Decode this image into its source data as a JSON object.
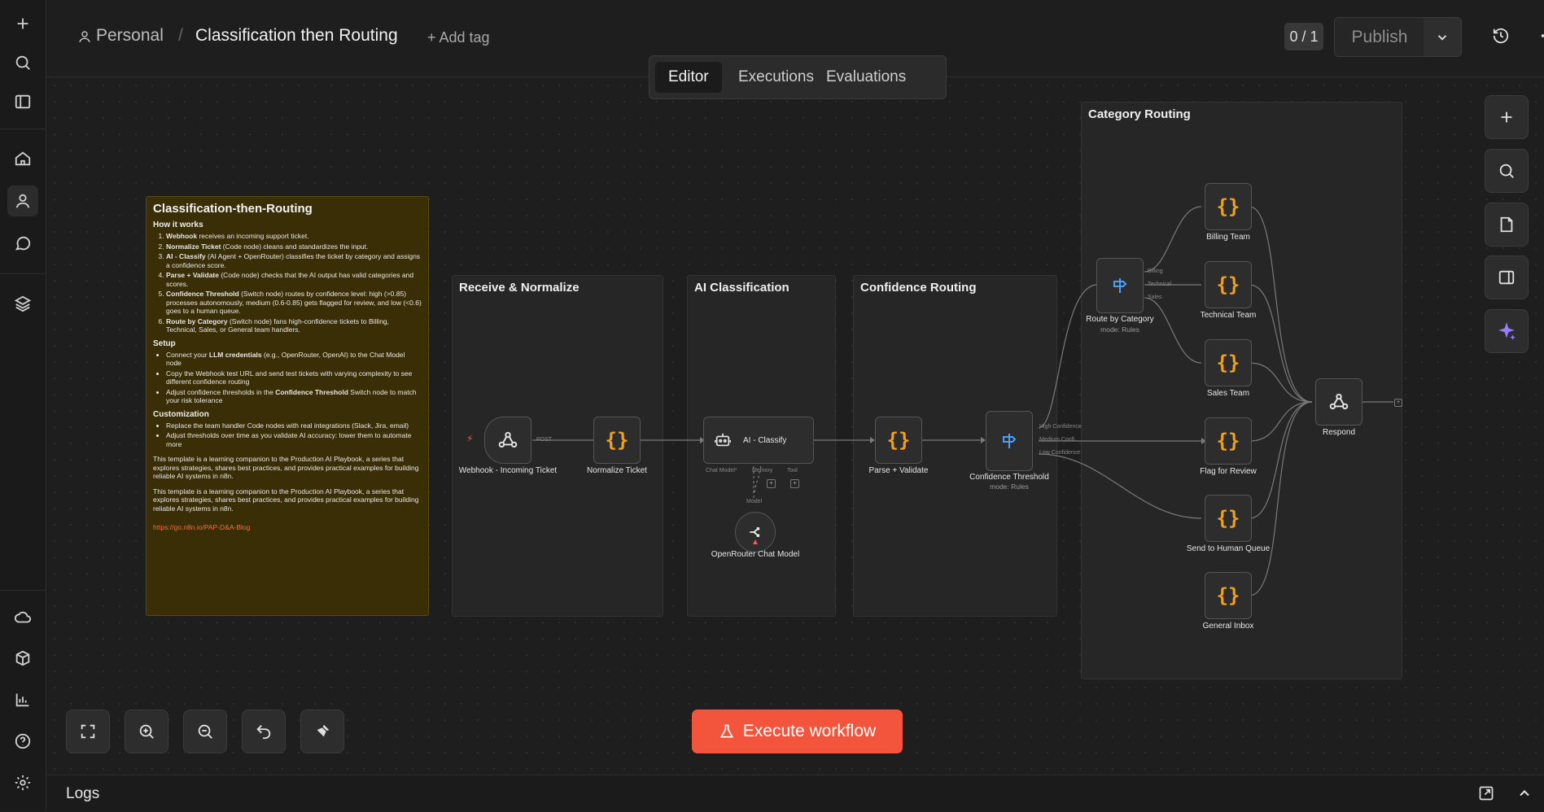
{
  "breadcrumb": {
    "project": "Personal",
    "separator": "/",
    "workflow_title": "Classification then Routing",
    "add_tag": "+ Add tag"
  },
  "tabs": [
    {
      "label": "Editor",
      "active": true
    },
    {
      "label": "Executions",
      "active": false
    },
    {
      "label": "Evaluations",
      "active": false
    }
  ],
  "header": {
    "counter": "0 / 1",
    "publish_label": "Publish"
  },
  "sidebar_icons": [
    "plus-icon",
    "search-icon",
    "panel-icon",
    "home-icon",
    "user-icon",
    "chat-icon",
    "layers-icon",
    "cloud-icon",
    "package-icon",
    "chart-icon",
    "help-icon",
    "gear-icon"
  ],
  "note": {
    "title": "Classification-then-Routing",
    "how_heading": "How it works",
    "steps": [
      {
        "bold": "Webhook",
        "text": " receives an incoming support ticket."
      },
      {
        "bold": "Normalize Ticket",
        "text": " (Code node) cleans and standardizes the input."
      },
      {
        "bold": "AI - Classify",
        "text": " (AI Agent + OpenRouter) classifies the ticket by category and assigns a confidence score."
      },
      {
        "bold": "Parse + Validate",
        "text": " (Code node) checks that the AI output has valid categories and scores."
      },
      {
        "bold": "Confidence Threshold",
        "text": " (Switch node) routes by confidence level: high (>0.85) processes autonomously, medium (0.6-0.85) gets flagged for review, and low (<0.6) goes to a human queue."
      },
      {
        "bold": "Route by Category",
        "text": " (Switch node) fans high-confidence tickets to Billing, Technical, Sales, or General team handlers."
      }
    ],
    "setup_heading": "Setup",
    "setup": [
      {
        "pre": "Connect your ",
        "bold": "LLM credentials",
        "post": " (e.g., OpenRouter, OpenAI) to the Chat Model node"
      },
      {
        "pre": "Copy the Webhook test URL and send test tickets with varying complexity to see different confidence routing",
        "bold": "",
        "post": ""
      },
      {
        "pre": "Adjust confidence thresholds in the ",
        "bold": "Confidence Threshold",
        "post": " Switch node to match your risk tolerance"
      }
    ],
    "custom_heading": "Customization",
    "custom": [
      "Replace the team handler Code nodes with real integrations (Slack, Jira, email)",
      "Adjust thresholds over time as you validate AI accuracy: lower them to automate more"
    ],
    "para1": "This template is a learning companion to the Production AI Playbook, a series that explores strategies, shares best practices, and provides practical examples for building reliable AI systems in n8n.",
    "para2": "This template is a learning companion to the Production AI Playbook, a series that explores strategies, shares best practices, and provides practical examples for building reliable AI systems in n8n.",
    "link": "https://go.n8n.io/PAP-D&A-Blog"
  },
  "groups": {
    "receive": "Receive & Normalize",
    "ai": "AI Classification",
    "confidence": "Confidence Routing",
    "category": "Category Routing"
  },
  "nodes": {
    "webhook": {
      "label": "Webhook - Incoming Ticket",
      "port": "POST"
    },
    "normalize": {
      "label": "Normalize Ticket"
    },
    "classify": {
      "label": "AI - Classify",
      "ports": [
        "Chat Model*",
        "Memory",
        "Tool"
      ]
    },
    "chat_model": {
      "label": "OpenRouter Chat Model",
      "port": "Model"
    },
    "parse": {
      "label": "Parse + Validate"
    },
    "threshold": {
      "label": "Confidence Threshold",
      "sub": "mode: Rules",
      "outputs": [
        "High Confidence",
        "Medium Confi...",
        "Low Confidence"
      ]
    },
    "route": {
      "label": "Route by Category",
      "sub": "mode: Rules",
      "outputs": [
        "Billing",
        "Technical",
        "Sales"
      ]
    },
    "billing": {
      "label": "Billing Team"
    },
    "technical": {
      "label": "Technical Team"
    },
    "sales": {
      "label": "Sales Team"
    },
    "flag": {
      "label": "Flag for Review"
    },
    "human": {
      "label": "Send to Human Queue"
    },
    "general": {
      "label": "General Inbox"
    },
    "respond": {
      "label": "Respond"
    }
  },
  "execute_label": "Execute workflow",
  "logs_label": "Logs",
  "colors": {
    "accent": "#f2553b",
    "code": "#f0a020",
    "switch": "#4d9fff",
    "note_bg": "#3a2e06"
  }
}
